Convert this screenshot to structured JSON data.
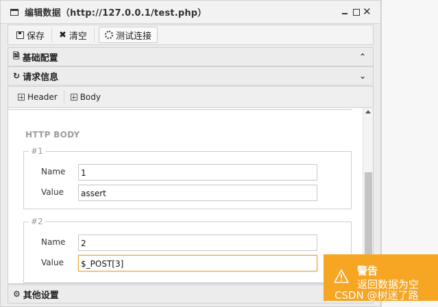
{
  "window": {
    "title": "编辑数据（http://127.0.0.1/test.php）"
  },
  "toolbar": {
    "save_label": "保存",
    "clear_label": "清空",
    "test_label": "测试连接"
  },
  "sections": {
    "basic_config": "基础配置",
    "request_info": "请求信息",
    "other_settings": "其他设置"
  },
  "tabs": [
    {
      "label": "Header"
    },
    {
      "label": "Body"
    }
  ],
  "http_body": {
    "heading": "HTTP BODY",
    "groups": [
      {
        "legend": "#1",
        "name_label": "Name",
        "name_value": "1",
        "value_label": "Value",
        "value_value": "assert"
      },
      {
        "legend": "#2",
        "name_label": "Name",
        "name_value": "2",
        "value_label": "Value",
        "value_value": "$_POST[3]"
      }
    ]
  },
  "toast": {
    "title": "警告",
    "message": "返回数据为空",
    "color": "#f6a623"
  },
  "watermark": "CSDN @树迷了路",
  "icons": {
    "window": "window-icon",
    "save": "save-icon",
    "clear": "close-icon",
    "test": "spinner-icon",
    "basic_config": "file-icon",
    "request_info": "refresh-icon",
    "other_settings": "gears-icon",
    "warning": "warning-icon"
  }
}
